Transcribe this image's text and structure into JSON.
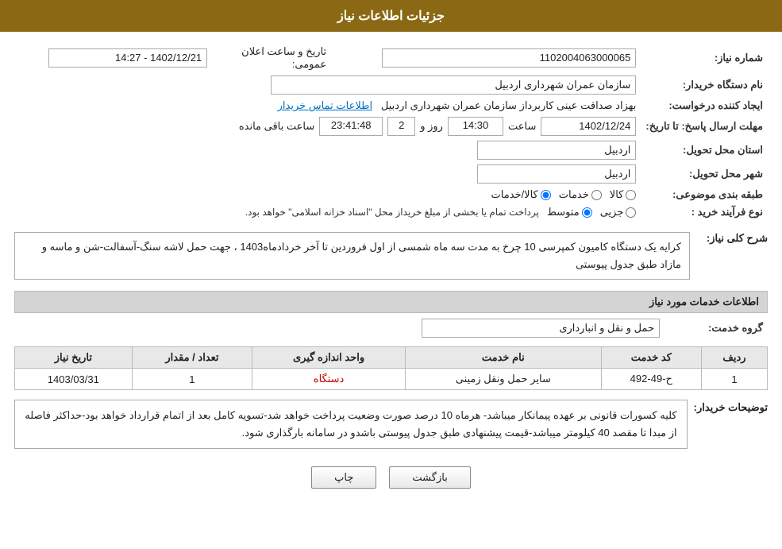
{
  "header": {
    "title": "جزئیات اطلاعات نیاز"
  },
  "fields": {
    "shomareNiaz_label": "شماره نیاز:",
    "shomareNiaz_value": "1102004063000065",
    "namDastgah_label": "نام دستگاه خریدار:",
    "namDastgah_value": "سازمان عمران شهرداری اردبیل",
    "ijadKonande_label": "ایجاد کننده درخواست:",
    "ijadKonande_value": "بهزاد  صداقت عینی کاربرداز سازمان عمران شهرداری اردبیل",
    "ijadKonande_link": "اطلاعات تماس خریدار",
    "tarikhArsal_label": "مهلت ارسال پاسخ: تا تاریخ:",
    "tarikhArsal_date": "1402/12/24",
    "tarikhArsal_saat": "14:30",
    "tarikhArsal_rooz": "2",
    "tarikhArsal_mande": "23:41:48",
    "tarikhElan_label": "تاریخ و ساعت اعلان عمومی:",
    "tarikhElan_value": "1402/12/21 - 14:27",
    "ostan_label": "استان محل تحویل:",
    "ostan_value": "اردبیل",
    "shahr_label": "شهر محل تحویل:",
    "shahr_value": "اردبیل",
    "tabaqe_label": "طبقه بندی موضوعی:",
    "tabaqe_kala": "کالا",
    "tabaqe_khadamat": "خدمات",
    "tabaqe_kala_khadamat": "کالا/خدمات",
    "noeFarayand_label": "نوع فرآیند خرید :",
    "noeFarayand_jozvi": "جزیی",
    "noeFarayand_motavasset": "متوسط",
    "noeFarayand_desc": "پرداخت تمام یا بخشی از مبلغ خریداز محل \"اسناد خزانه اسلامی\" خواهد بود.",
    "sharhKoli_label": "شرح کلی نیاز:",
    "sharhKoli_value": "کرایه یک دستگاه کامیون کمپرسی 10 چرخ به مدت سه ماه شمسی از اول فروردین تا آخر خردادماه1403 ، جهت حمل لاشه سنگ-آسفالت-شن و ماسه و مازاد طبق جدول پیوستی",
    "khadamat_label": "اطلاعات خدمات مورد نیاز",
    "gorohKhadamat_label": "گروه خدمت:",
    "gorohKhadamat_value": "حمل و نقل و انبارداری",
    "table": {
      "headers": [
        "ردیف",
        "کد خدمت",
        "نام خدمت",
        "واحد اندازه گیری",
        "تعداد / مقدار",
        "تاریخ نیاز"
      ],
      "rows": [
        {
          "radif": "1",
          "kodKhadamat": "ح-49-492",
          "namKhadamat": "سایر حمل ونقل زمینی",
          "vahed": "دستگاه",
          "tedad": "1",
          "tarikh": "1403/03/31"
        }
      ]
    },
    "touzihKharidar_label": "توضیحات خریدار:",
    "touzihKharidar_value": "کلیه کسورات قانونی بر عهده پیمانکار میباشد- هرماه 10 درصد صورت وضعیت پرداخت خواهد شد-تسویه کامل بعد از اتمام قرارداد خواهد بود-حداکثر فاصله از مبدا تا مقصد 40 کیلومتر میباشد-قیمت پیشنهادی طبق جدول پیوستی باشدو در سامانه بارگذاری شود."
  },
  "buttons": {
    "back_label": "بازگشت",
    "print_label": "چاپ"
  }
}
